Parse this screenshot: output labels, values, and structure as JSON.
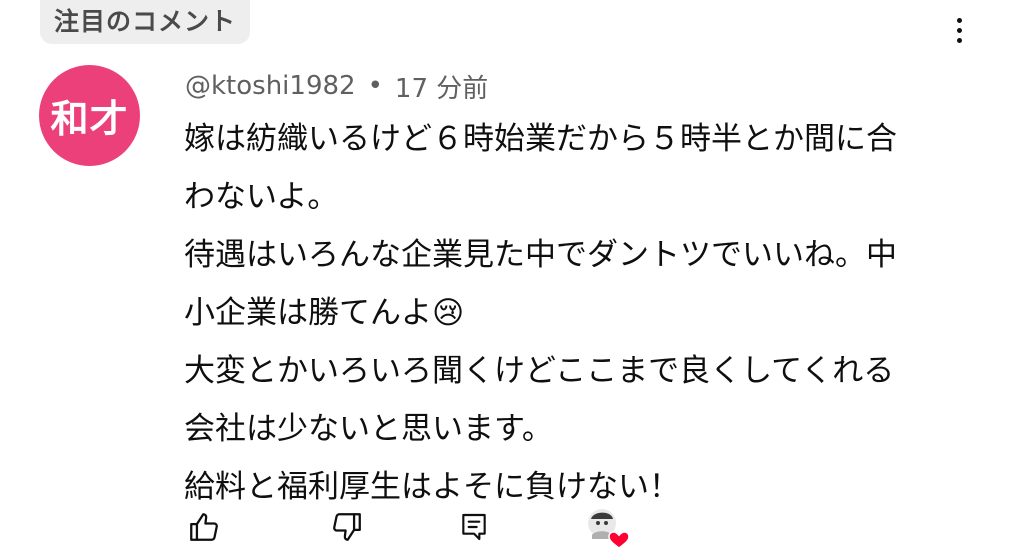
{
  "header": {
    "featured_label": "注目のコメント",
    "menu_icon": "more-vert-icon"
  },
  "comment": {
    "avatar_text": "和才",
    "avatar_color": "#ec407a",
    "author": "@ktoshi1982",
    "separator": "•",
    "time": "17 分前",
    "lines": [
      "嫁は紡織いるけど６時始業だから５時半とか間に合",
      "わないよ。",
      "待遇はいろんな企業見た中でダントツでいいね。中",
      "小企業は勝てんよ😢",
      "大変とかいろいろ聞くけどここまで良くしてくれる",
      "会社は少ないと思います。",
      "給料と福利厚生はよそに負けない！"
    ]
  },
  "actions": {
    "like_icon": "thumb-up-icon",
    "dislike_icon": "thumb-down-icon",
    "reply_icon": "comment-reply-icon",
    "creator_heart_icon": "creator-heart-icon",
    "heart_color": "#ff0033"
  }
}
